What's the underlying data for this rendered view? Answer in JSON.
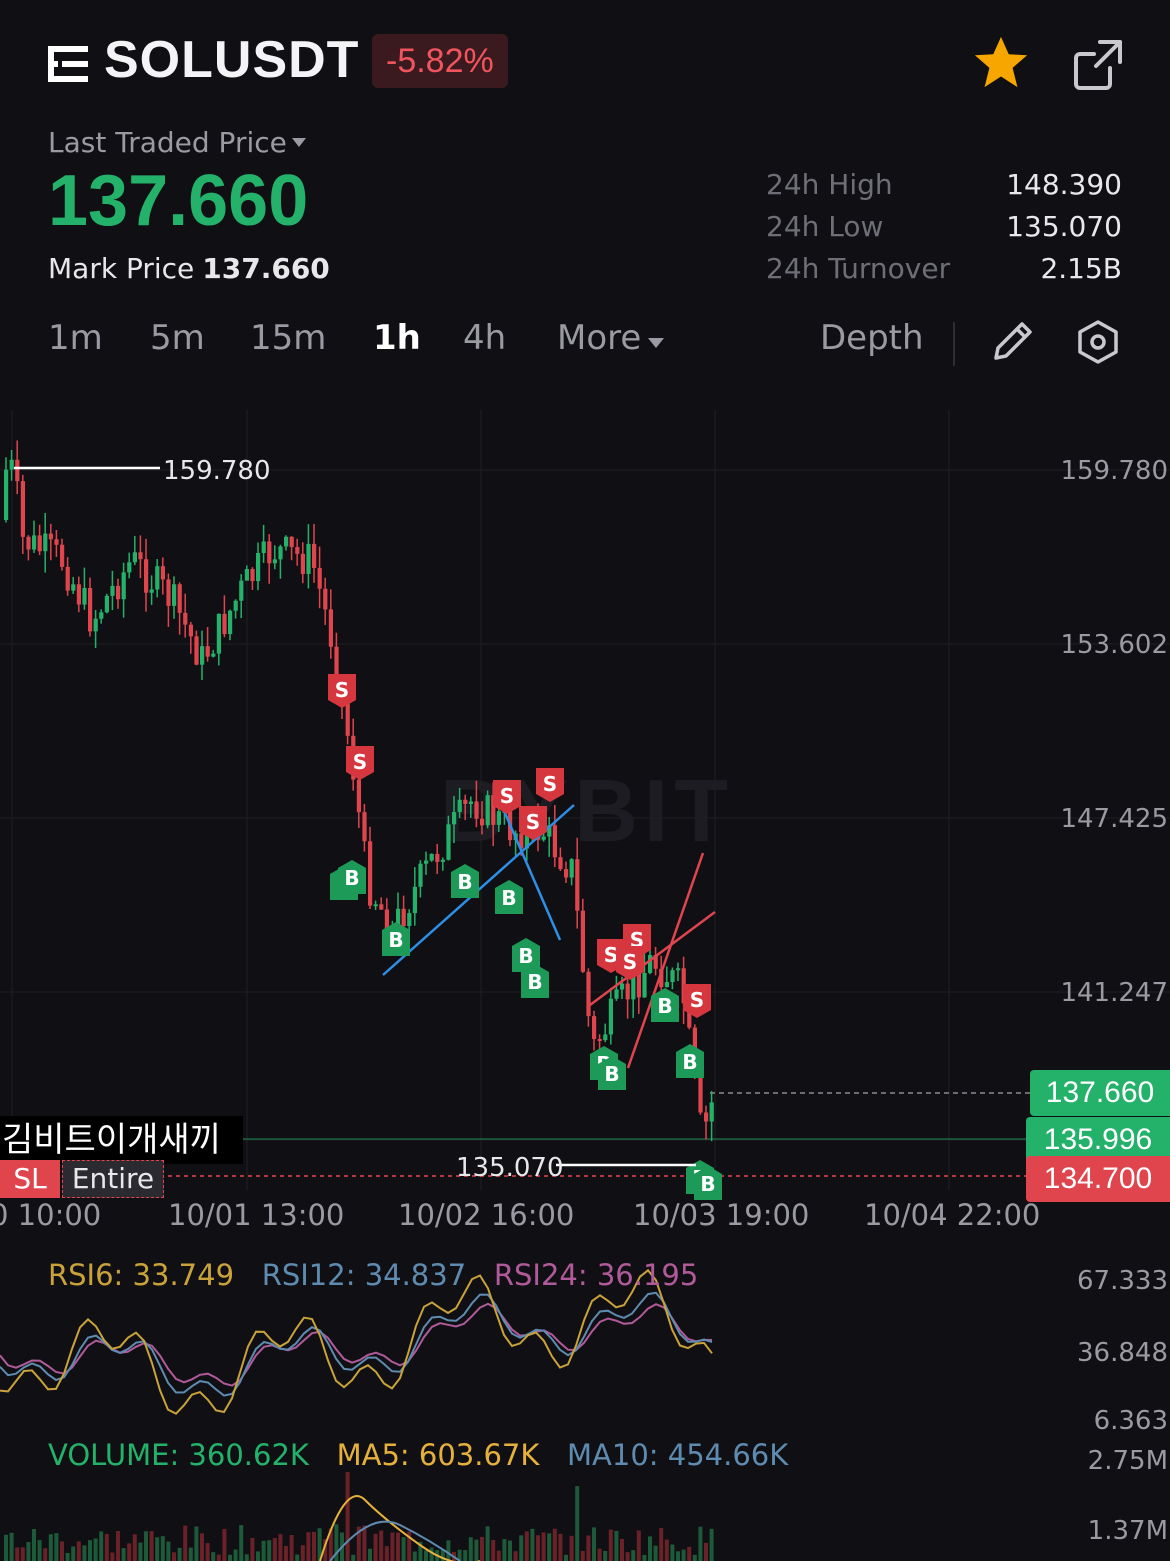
{
  "header": {
    "symbol": "SOLUSDT",
    "change": "-5.82%",
    "menu_icon": "list-menu-icon",
    "favorite_icon": "star-icon",
    "share_icon": "external-link-icon",
    "colors": {
      "up": "#24b26b",
      "down": "#e0454e",
      "accent_star": "#f7a600"
    }
  },
  "price_panel": {
    "price_type_label": "Last Traded Price",
    "last_price": "137.660",
    "mark_label": "Mark Price",
    "mark_price": "137.660",
    "stats": [
      {
        "label": "24h High",
        "value": "148.390"
      },
      {
        "label": "24h Low",
        "value": "135.070"
      },
      {
        "label": "24h Turnover",
        "value": "2.15B"
      }
    ]
  },
  "timeframes": {
    "items": [
      "1m",
      "5m",
      "15m",
      "1h",
      "4h",
      "More"
    ],
    "active": "1h",
    "depth_label": "Depth",
    "draw_icon": "pencil-icon",
    "settings_icon": "gear-icon"
  },
  "chart": {
    "watermark": "BYBIT",
    "y_labels": [
      "159.780",
      "153.602",
      "147.425",
      "141.247"
    ],
    "x_labels": [
      "0 10:00",
      "10/01 13:00",
      "10/02 16:00",
      "10/03 19:00",
      "10/04 22:00"
    ],
    "high_marker": "159.780",
    "low_marker": "135.070",
    "last_price_tag": "137.660",
    "entry_tag": "135.996",
    "sl_tag": "134.700",
    "order_label": "김비트이개새끼",
    "sl_label": "SL",
    "sl_scope": "Entire",
    "buy_marker": "B",
    "sell_marker": "S"
  },
  "rsi": {
    "rsi6_label": "RSI6: 33.749",
    "rsi12_label": "RSI12: 34.837",
    "rsi24_label": "RSI24: 36.195",
    "y_labels": [
      "67.333",
      "36.848",
      "6.363"
    ],
    "colors": {
      "rsi6": "#c9a23a",
      "rsi12": "#5e8bb0",
      "rsi24": "#b05a9a"
    }
  },
  "volume": {
    "volume_label": "VOLUME: 360.62K",
    "ma5_label": "MA5: 603.67K",
    "ma10_label": "MA10: 454.66K",
    "y_labels": [
      "2.75M",
      "1.37M"
    ],
    "colors": {
      "volume": "#24b26b",
      "ma5": "#e6b13a",
      "ma10": "#5e8bb0"
    }
  }
}
